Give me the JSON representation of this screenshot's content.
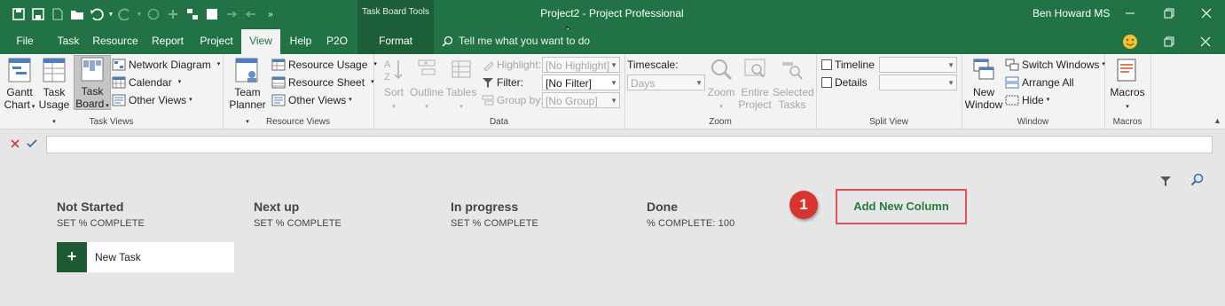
{
  "title_bar": {
    "contextual_header": "Task Board Tools",
    "window_title": "Project2 - Project Professional",
    "user_name": "Ben Howard MS",
    "accent": "#217346"
  },
  "tabs": {
    "file": "File",
    "task": "Task",
    "resource": "Resource",
    "report": "Report",
    "project": "Project",
    "view": "View",
    "help": "Help",
    "p2o": "P2O",
    "format": "Format",
    "tell_me": "Tell me what you want to do"
  },
  "ribbon": {
    "task_views": {
      "label": "Task Views",
      "gantt_l1": "Gantt",
      "gantt_l2": "Chart",
      "usage_l1": "Task",
      "usage_l2": "Usage",
      "board_l1": "Task",
      "board_l2": "Board",
      "network": "Network Diagram",
      "calendar": "Calendar",
      "other": "Other Views"
    },
    "resource_views": {
      "label": "Resource Views",
      "team_l1": "Team",
      "team_l2": "Planner",
      "usage": "Resource Usage",
      "sheet": "Resource Sheet",
      "other": "Other Views"
    },
    "data": {
      "label": "Data",
      "sort": "Sort",
      "outline": "Outline",
      "tables": "Tables",
      "highlight_label": "Highlight:",
      "highlight_value": "[No Highlight]",
      "filter_label": "Filter:",
      "filter_value": "[No Filter]",
      "group_label": "Group by:",
      "group_value": "[No Group]"
    },
    "zoom": {
      "label": "Zoom",
      "timescale_label": "Timescale:",
      "timescale_value": "Days",
      "zoom": "Zoom",
      "entire_l1": "Entire",
      "entire_l2": "Project",
      "selected_l1": "Selected",
      "selected_l2": "Tasks"
    },
    "split_view": {
      "label": "Split View",
      "timeline": "Timeline",
      "details": "Details"
    },
    "window": {
      "label": "Window",
      "new_l1": "New",
      "new_l2": "Window",
      "switch": "Switch Windows",
      "arrange": "Arrange All",
      "hide": "Hide"
    },
    "macros": {
      "label": "Macros",
      "macros": "Macros"
    }
  },
  "board": {
    "columns": [
      {
        "title": "Not Started",
        "subtitle": "SET % COMPLETE"
      },
      {
        "title": "Next up",
        "subtitle": "SET % COMPLETE"
      },
      {
        "title": "In progress",
        "subtitle": "SET % COMPLETE"
      },
      {
        "title": "Done",
        "subtitle": "% COMPLETE: 100"
      }
    ],
    "new_task_plus": "+",
    "new_task_label": "New Task",
    "callout_number": "1",
    "add_column": "Add New Column"
  }
}
